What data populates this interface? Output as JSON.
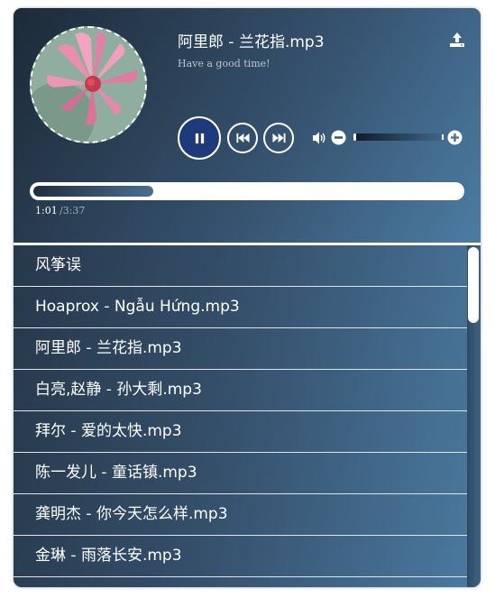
{
  "now_playing": {
    "title": "阿里郎 - 兰花指.mp3",
    "tagline": "Have a good time!",
    "current_time": "1:01",
    "total_time": "/3:37",
    "progress": 0.28
  },
  "controls": {
    "play_state": "playing",
    "icons": [
      "pause-icon",
      "skip-back-icon",
      "skip-forward-icon",
      "volume-icon",
      "minus-icon",
      "plus-icon",
      "upload-icon"
    ],
    "volume": 0.0
  },
  "playlist": [
    "风筝误",
    "Hoaprox - Ngẫu Hứng.mp3",
    "阿里郎 - 兰花指.mp3",
    "白亮,赵静 - 孙大剩.mp3",
    "拜尔 - 爱的太快.mp3",
    "陈一发儿 - 童话镇.mp3",
    "龚明杰 - 你今天怎么样.mp3",
    "金琳 - 雨落长安.mp3"
  ],
  "colors": {
    "accent": "#1f3a7a",
    "panel_dark": "#243446",
    "panel_light": "#4b7aa1"
  }
}
